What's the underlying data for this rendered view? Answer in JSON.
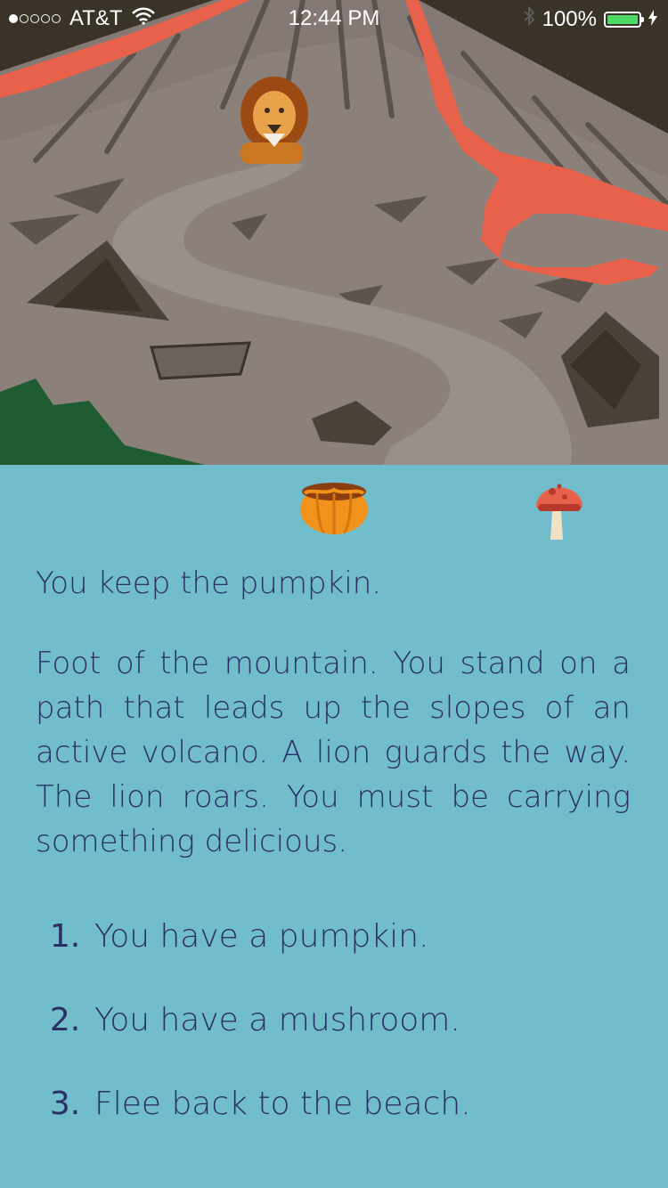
{
  "status_bar": {
    "carrier": "AT&T",
    "time": "12:44 PM",
    "battery": "100%",
    "icons": [
      "signal-dots",
      "wifi-icon",
      "bluetooth-icon",
      "battery-icon",
      "charging-icon"
    ]
  },
  "scene": {
    "icons": [
      "volcano-illustration",
      "lion-icon",
      "lava-flow",
      "rocks",
      "path"
    ]
  },
  "inventory": {
    "items": [
      {
        "name": "pumpkin",
        "icon": "pumpkin-icon"
      },
      {
        "name": "mushroom",
        "icon": "mushroom-icon"
      }
    ]
  },
  "story": {
    "intro": "You keep the pumpkin.",
    "description": "Foot of the mountain. You stand on a path that leads up the slopes of an active volcano. A lion guards the way. The lion roars. You must be carrying something delicious."
  },
  "choices": [
    {
      "number": "1.",
      "label": "You have a pumpkin."
    },
    {
      "number": "2.",
      "label": "You have a mushroom."
    },
    {
      "number": "3.",
      "label": "Flee back to the beach."
    }
  ],
  "colors": {
    "background": "#72bdcc",
    "text": "#2a2f66",
    "lava": "#e8614b",
    "rock": "#7f7370"
  }
}
